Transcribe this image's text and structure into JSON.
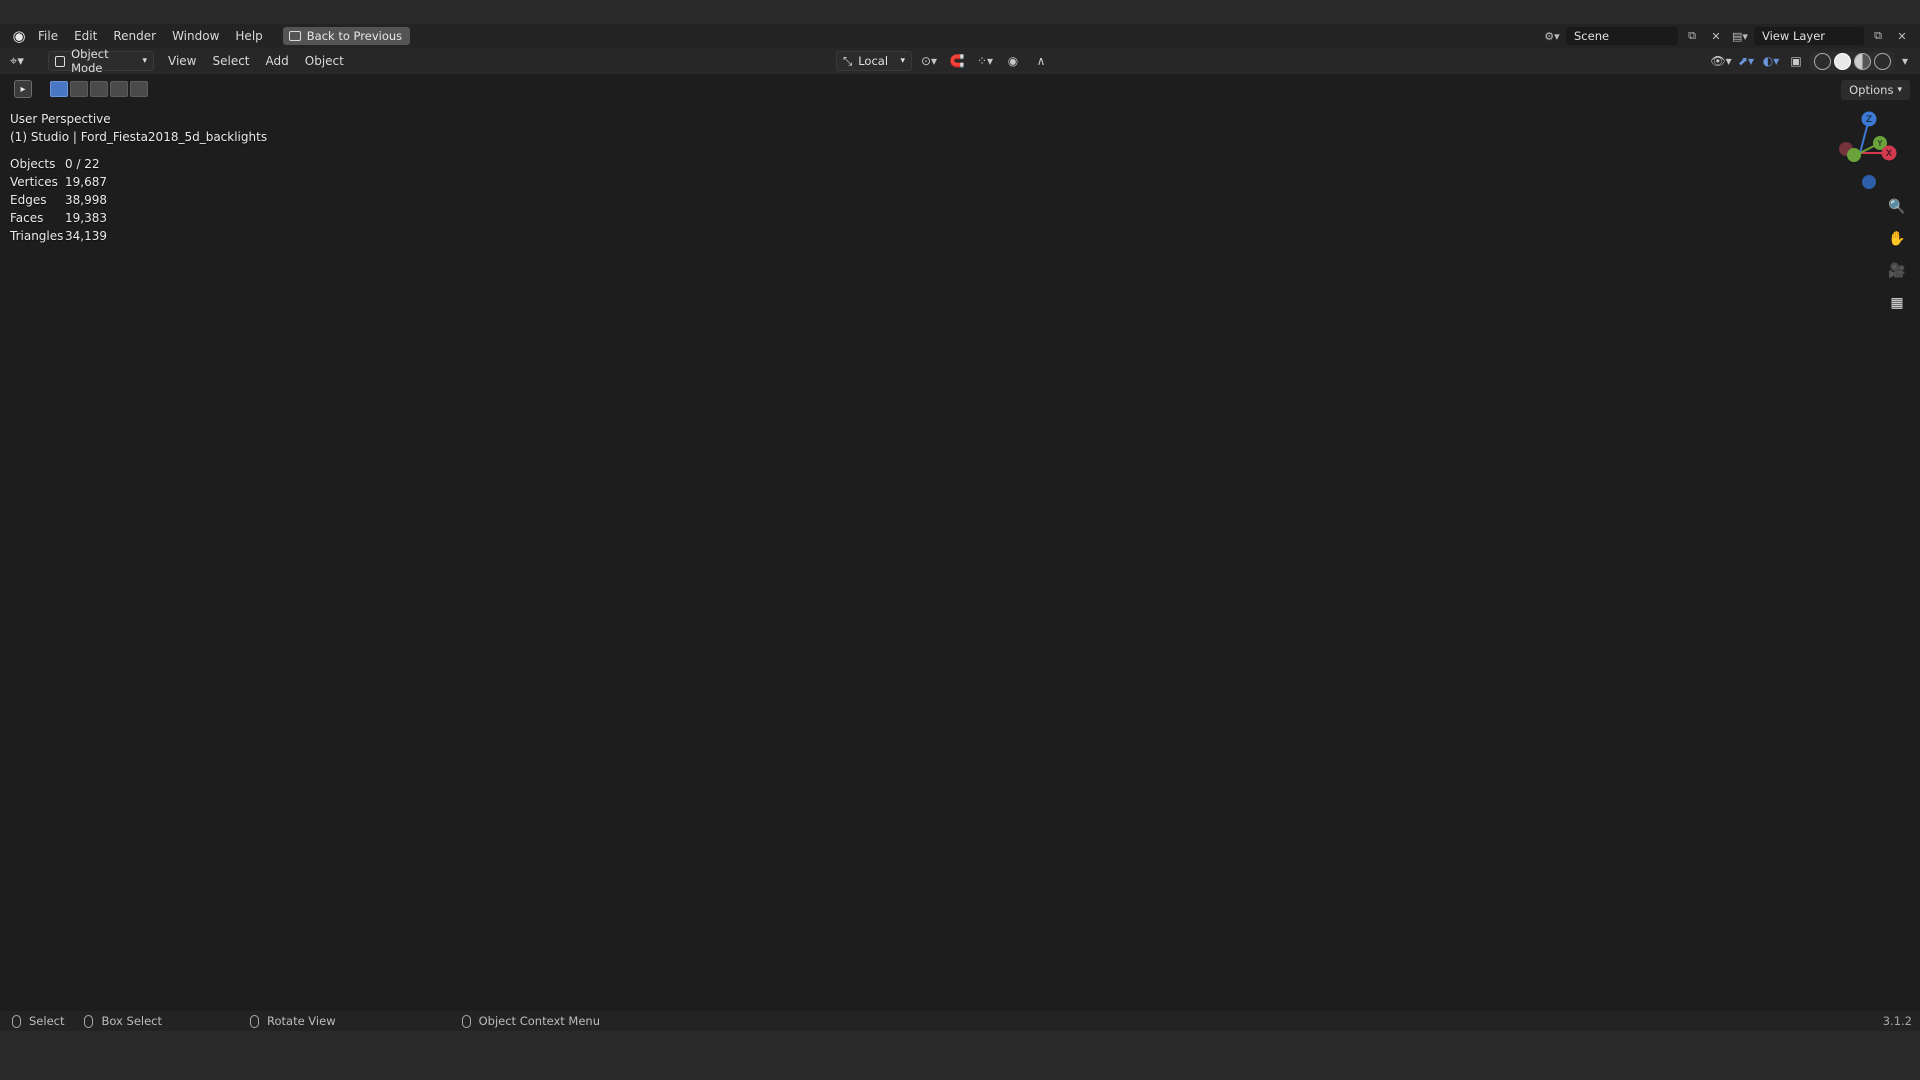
{
  "topbar": {
    "menus": [
      "File",
      "Edit",
      "Render",
      "Window",
      "Help"
    ],
    "back_button": "Back to Previous",
    "scene": "Scene",
    "view_layer": "View Layer"
  },
  "header": {
    "mode": "Object Mode",
    "menus": [
      "View",
      "Select",
      "Add",
      "Object"
    ],
    "orientation": "Local",
    "options_label": "Options"
  },
  "viewport": {
    "perspective": "User Perspective",
    "object_label": "(1) Studio | Ford_Fiesta2018_5d_backlights",
    "stats": [
      {
        "label": "Objects",
        "value": "0 / 22"
      },
      {
        "label": "Vertices",
        "value": "19,687"
      },
      {
        "label": "Edges",
        "value": "38,998"
      },
      {
        "label": "Faces",
        "value": "19,383"
      },
      {
        "label": "Triangles",
        "value": "34,139"
      }
    ],
    "gizmo_axes": {
      "z": "Z",
      "y": "Y",
      "x": "X"
    }
  },
  "statusbar": {
    "select": "Select",
    "box_select": "Box Select",
    "rotate_view": "Rotate View",
    "context_menu": "Object Context Menu",
    "version": "3.1.2"
  },
  "colors": {
    "accent": "#4a77c3",
    "floor": "#9a5044",
    "car": "#8c4538",
    "viewport_bg": "#3c3c3c"
  }
}
